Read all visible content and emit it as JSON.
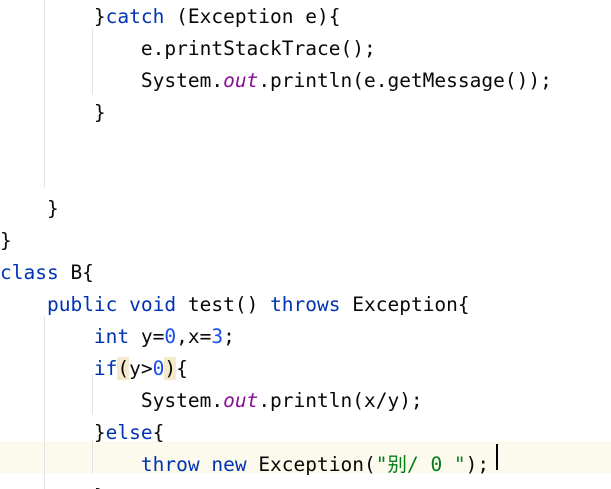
{
  "editor": {
    "lines": [
      {
        "indent": "        ",
        "tokens": [
          {
            "t": "}",
            "c": "plain"
          },
          {
            "t": "catch",
            "c": "kw"
          },
          {
            "t": " (Exception e){",
            "c": "plain"
          }
        ]
      },
      {
        "indent": "            ",
        "tokens": [
          {
            "t": "e.printStackTrace();",
            "c": "plain"
          }
        ]
      },
      {
        "indent": "            ",
        "tokens": [
          {
            "t": "System.",
            "c": "plain"
          },
          {
            "t": "out",
            "c": "fld"
          },
          {
            "t": ".println(e.getMessage());",
            "c": "plain"
          }
        ]
      },
      {
        "indent": "        ",
        "tokens": [
          {
            "t": "}",
            "c": "plain"
          }
        ]
      },
      {
        "indent": "",
        "tokens": []
      },
      {
        "indent": "",
        "tokens": []
      },
      {
        "indent": "    ",
        "tokens": [
          {
            "t": "}",
            "c": "plain"
          }
        ]
      },
      {
        "indent": "",
        "tokens": [
          {
            "t": "}",
            "c": "plain"
          }
        ]
      },
      {
        "indent": "",
        "tokens": [
          {
            "t": "class",
            "c": "kw"
          },
          {
            "t": " B{",
            "c": "plain"
          }
        ]
      },
      {
        "indent": "    ",
        "tokens": [
          {
            "t": "public",
            "c": "kw"
          },
          {
            "t": " ",
            "c": "plain"
          },
          {
            "t": "void",
            "c": "kw"
          },
          {
            "t": " test() ",
            "c": "plain"
          },
          {
            "t": "throws",
            "c": "kw"
          },
          {
            "t": " Exception{",
            "c": "plain"
          }
        ]
      },
      {
        "indent": "        ",
        "tokens": [
          {
            "t": "int",
            "c": "kw"
          },
          {
            "t": " y=",
            "c": "plain"
          },
          {
            "t": "0",
            "c": "num"
          },
          {
            "t": ",x=",
            "c": "plain"
          },
          {
            "t": "3",
            "c": "num"
          },
          {
            "t": ";",
            "c": "plain"
          }
        ]
      },
      {
        "indent": "        ",
        "tokens": [
          {
            "t": "if",
            "c": "kw"
          },
          {
            "t": "(",
            "c": "plain match"
          },
          {
            "t": "y>",
            "c": "plain"
          },
          {
            "t": "0",
            "c": "num"
          },
          {
            "t": ")",
            "c": "plain match"
          },
          {
            "t": "{",
            "c": "plain"
          }
        ]
      },
      {
        "indent": "            ",
        "tokens": [
          {
            "t": "System.",
            "c": "plain"
          },
          {
            "t": "out",
            "c": "fld"
          },
          {
            "t": ".println(x/y);",
            "c": "plain"
          }
        ]
      },
      {
        "indent": "        ",
        "tokens": [
          {
            "t": "}",
            "c": "plain"
          },
          {
            "t": "else",
            "c": "kw"
          },
          {
            "t": "{",
            "c": "plain"
          }
        ]
      },
      {
        "indent": "            ",
        "tokens": [
          {
            "t": "throw",
            "c": "kw"
          },
          {
            "t": " ",
            "c": "plain"
          },
          {
            "t": "new",
            "c": "kw"
          },
          {
            "t": " Exception(",
            "c": "plain"
          },
          {
            "t": "\"别/ 0 \"",
            "c": "str"
          },
          {
            "t": ");",
            "c": "plain"
          }
        ]
      },
      {
        "indent": "        ",
        "tokens": [
          {
            "t": "}",
            "c": "plain"
          }
        ]
      }
    ]
  }
}
